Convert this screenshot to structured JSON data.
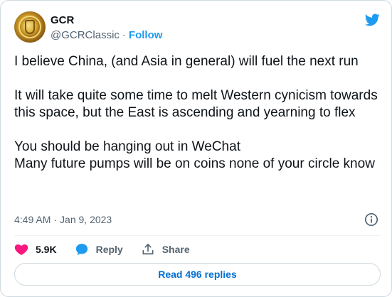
{
  "author": {
    "name": "GCR",
    "handle": "@GCRClassic",
    "separator": "·",
    "follow_label": "Follow"
  },
  "tweet": {
    "paragraphs": [
      [
        "I believe China, (and Asia in general) will fuel the next run"
      ],
      [
        "It will take quite some time to melt Western cynicism towards this space, but the East is ascending and yearning to flex"
      ],
      [
        "You should be hanging out in WeChat",
        "Many future pumps will be on coins none of your circle know"
      ]
    ]
  },
  "meta": {
    "time": "4:49 AM",
    "separator": "·",
    "date": "Jan 9, 2023"
  },
  "actions": {
    "like_count": "5.9K",
    "reply_label": "Reply",
    "share_label": "Share"
  },
  "read_replies_label": "Read 496 replies",
  "icons": {
    "avatar": "gold-coin-avatar",
    "brand": "twitter-bird-icon",
    "info": "info-icon",
    "like": "heart-icon",
    "reply": "speech-bubble-icon",
    "share": "share-upload-icon"
  },
  "colors": {
    "brand_blue": "#1d9bf0",
    "like_pink": "#f91880",
    "text_primary": "#0f1419",
    "text_secondary": "#536471",
    "replies_link": "#006fd6",
    "border": "#cfd9de"
  }
}
